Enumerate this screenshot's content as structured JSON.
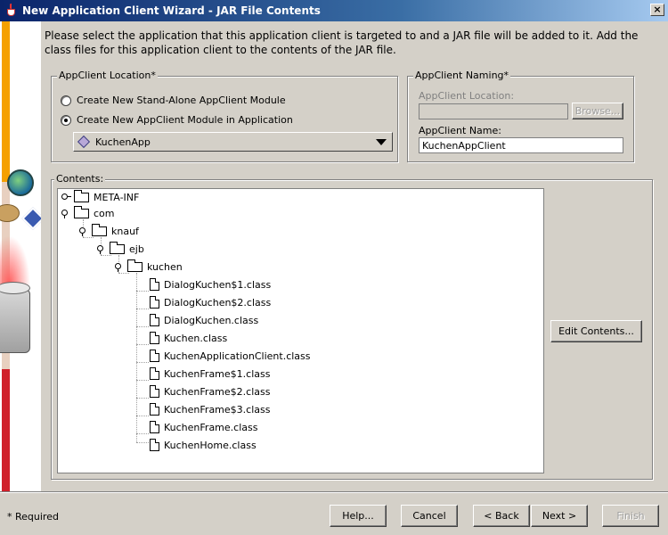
{
  "window": {
    "title": "New Application Client Wizard - JAR File Contents",
    "close_glyph": "×"
  },
  "instructions": "Please select the application that this application client is targeted to and a JAR file will be added to it.  Add the class files for this application client to the contents of the JAR file.",
  "location": {
    "group_label": "AppClient Location*",
    "options": [
      {
        "label": "Create New Stand-Alone AppClient Module",
        "checked": false
      },
      {
        "label": "Create New AppClient Module in Application",
        "checked": true
      }
    ],
    "application_select": {
      "value": "KuchenApp",
      "icon": "application-diamond-icon"
    }
  },
  "naming": {
    "group_label": "AppClient Naming*",
    "location_label": "AppClient Location:",
    "location_value": "",
    "browse_label": "Browse...",
    "name_label": "AppClient Name:",
    "name_value": "KuchenAppClient"
  },
  "contents": {
    "group_label": "Contents:",
    "edit_button": "Edit Contents...",
    "tree": [
      {
        "label": "META-INF",
        "type": "folder",
        "level": 0,
        "expanded": false
      },
      {
        "label": "com",
        "type": "folder",
        "level": 0,
        "expanded": true
      },
      {
        "label": "knauf",
        "type": "folder",
        "level": 1,
        "expanded": true
      },
      {
        "label": "ejb",
        "type": "folder",
        "level": 2,
        "expanded": true
      },
      {
        "label": "kuchen",
        "type": "folder",
        "level": 3,
        "expanded": true
      },
      {
        "label": "DialogKuchen$1.class",
        "type": "file",
        "level": 4
      },
      {
        "label": "DialogKuchen$2.class",
        "type": "file",
        "level": 4
      },
      {
        "label": "DialogKuchen.class",
        "type": "file",
        "level": 4
      },
      {
        "label": "Kuchen.class",
        "type": "file",
        "level": 4
      },
      {
        "label": "KuchenApplicationClient.class",
        "type": "file",
        "level": 4
      },
      {
        "label": "KuchenFrame$1.class",
        "type": "file",
        "level": 4
      },
      {
        "label": "KuchenFrame$2.class",
        "type": "file",
        "level": 4
      },
      {
        "label": "KuchenFrame$3.class",
        "type": "file",
        "level": 4
      },
      {
        "label": "KuchenFrame.class",
        "type": "file",
        "level": 4
      },
      {
        "label": "KuchenHome.class",
        "type": "file",
        "level": 4
      }
    ]
  },
  "footer": {
    "required_note": "* Required",
    "buttons": {
      "help": "Help...",
      "cancel": "Cancel",
      "back": "< Back",
      "next": "Next >",
      "finish": "Finish"
    }
  }
}
